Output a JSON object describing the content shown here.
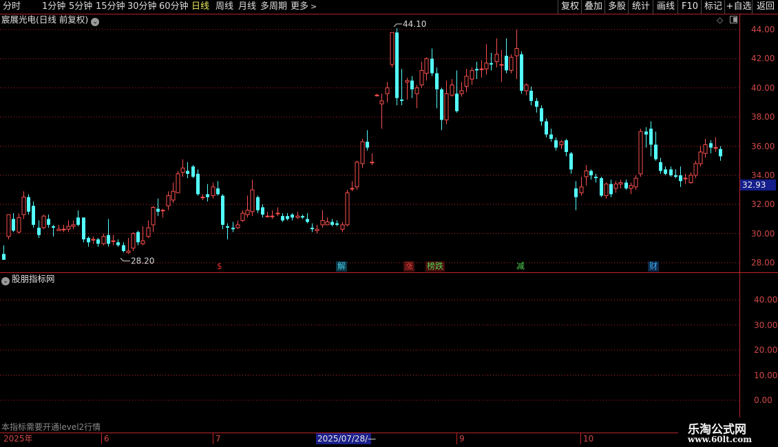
{
  "toolbar": {
    "periods": [
      "分时",
      "1分钟",
      "5分钟",
      "15分钟",
      "30分钟",
      "60分钟",
      "日线",
      "周线",
      "月线",
      "多周期",
      "更多"
    ],
    "active_period": "日线",
    "right_buttons": [
      "复权",
      "叠加",
      "多股",
      "统计",
      "画线",
      "F10",
      "标记",
      "+自选",
      "返回"
    ]
  },
  "stock": {
    "title": "宸展光电(日线 前复权)",
    "max_label": "44.10",
    "min_label": "28.20",
    "last_price": "32.93"
  },
  "events": [
    {
      "label": "$",
      "color": "#e03030",
      "bg": "#000000"
    },
    {
      "label": "解",
      "color": "#40c8e0",
      "bg": "#0d3848"
    },
    {
      "label": "涨",
      "color": "#e04040",
      "bg": "#4a0d0d"
    },
    {
      "label": "榜跌",
      "color": "#50d050",
      "bg": "#4a0d0d"
    },
    {
      "label": "减",
      "color": "#50d050",
      "bg": "#000000"
    },
    {
      "label": "财",
      "color": "#40a8e8",
      "bg": "#0d2848"
    }
  ],
  "main_axis": [
    "44.00",
    "42.00",
    "40.00",
    "38.00",
    "36.00",
    "34.00",
    "32.00",
    "30.00",
    "28.00"
  ],
  "indicator": {
    "title": "股朋指标网",
    "axis": [
      "40.00",
      "30.00",
      "20.00",
      "10.00",
      "0.00"
    ],
    "note": "本指标需要开通level2行情"
  },
  "dates": {
    "labels": [
      "2025年",
      "6",
      "7",
      "9",
      "10"
    ],
    "cursor": "2025/07/28/—"
  },
  "watermark": {
    "cn": "乐淘公式网",
    "url": "www.60lt.com"
  },
  "colors": {
    "up": "#ff5050",
    "down": "#54ffff",
    "grid": "#c0272d",
    "cursor_bg": "#141e8c"
  },
  "chart_data": {
    "type": "candlestick",
    "ylim": [
      27.5,
      44.5
    ],
    "candles": [
      [
        28.6,
        28.2,
        28.2,
        29.2
      ],
      [
        29.8,
        31.3,
        29.6,
        31.3
      ],
      [
        31.0,
        30.2,
        30.1,
        31.4
      ],
      [
        30.1,
        31.1,
        30.0,
        31.4
      ],
      [
        31.3,
        32.5,
        31.0,
        32.9
      ],
      [
        32.5,
        31.5,
        31.3,
        32.7
      ],
      [
        31.9,
        30.6,
        30.4,
        32.2
      ],
      [
        30.4,
        29.9,
        29.7,
        30.9
      ],
      [
        30.4,
        31.2,
        30.3,
        31.3
      ],
      [
        31.0,
        30.6,
        30.4,
        31.3
      ],
      [
        30.5,
        30.4,
        29.8,
        30.6
      ],
      [
        30.2,
        30.3,
        30.2,
        30.6
      ],
      [
        30.3,
        30.3,
        30.1,
        30.6
      ],
      [
        30.3,
        30.5,
        30.1,
        30.9
      ],
      [
        30.5,
        30.6,
        30.3,
        30.9
      ],
      [
        31.1,
        30.6,
        30.5,
        31.6
      ],
      [
        31.1,
        29.6,
        29.4,
        31.1
      ],
      [
        29.7,
        29.4,
        29.1,
        29.8
      ],
      [
        29.6,
        29.6,
        29.3,
        29.8
      ],
      [
        29.6,
        29.3,
        29.1,
        29.7
      ],
      [
        29.3,
        29.8,
        29.2,
        30.0
      ],
      [
        29.9,
        29.3,
        29.1,
        31.0
      ],
      [
        29.5,
        29.5,
        29.2,
        29.9
      ],
      [
        29.4,
        29.2,
        29.1,
        29.6
      ],
      [
        29.2,
        28.8,
        28.7,
        29.4
      ],
      [
        28.7,
        28.8,
        28.6,
        29.7
      ],
      [
        29.0,
        30.0,
        28.8,
        30.1
      ],
      [
        30.1,
        29.4,
        29.2,
        30.2
      ],
      [
        29.3,
        29.5,
        29.2,
        30.5
      ],
      [
        29.8,
        30.4,
        29.7,
        30.9
      ],
      [
        30.6,
        31.8,
        30.1,
        31.9
      ],
      [
        31.7,
        31.5,
        31.2,
        32.4
      ],
      [
        31.6,
        31.6,
        31.1,
        31.7
      ],
      [
        31.9,
        32.6,
        31.6,
        32.9
      ],
      [
        32.3,
        32.9,
        32.1,
        33.5
      ],
      [
        32.8,
        34.1,
        32.8,
        34.3
      ],
      [
        34.2,
        34.5,
        33.9,
        35.1
      ],
      [
        34.3,
        34.1,
        33.8,
        34.9
      ],
      [
        34.6,
        33.9,
        33.8,
        34.7
      ],
      [
        34.1,
        32.7,
        32.6,
        34.4
      ],
      [
        32.5,
        32.5,
        32.3,
        32.7
      ],
      [
        32.7,
        32.5,
        32.2,
        33.4
      ],
      [
        32.6,
        33.2,
        32.4,
        33.5
      ],
      [
        33.1,
        32.7,
        32.6,
        33.6
      ],
      [
        32.6,
        30.6,
        30.3,
        32.7
      ],
      [
        30.5,
        30.4,
        29.6,
        30.7
      ],
      [
        30.4,
        30.3,
        30.1,
        30.8
      ],
      [
        30.4,
        30.6,
        30.3,
        30.9
      ],
      [
        30.9,
        31.4,
        30.8,
        31.6
      ],
      [
        31.3,
        31.6,
        31.1,
        32.6
      ],
      [
        31.5,
        33.0,
        31.2,
        33.7
      ],
      [
        32.5,
        31.6,
        31.4,
        32.6
      ],
      [
        31.8,
        31.3,
        31.1,
        32.0
      ],
      [
        31.2,
        31.2,
        31.1,
        31.5
      ],
      [
        31.2,
        31.2,
        31.0,
        31.6
      ],
      [
        31.4,
        31.4,
        31.2,
        31.8
      ],
      [
        31.2,
        30.9,
        30.8,
        31.4
      ],
      [
        31.2,
        31.0,
        30.9,
        31.4
      ],
      [
        31.3,
        31.1,
        30.9,
        31.4
      ],
      [
        31.1,
        31.2,
        31.0,
        31.5
      ],
      [
        31.2,
        31.1,
        31.0,
        31.3
      ],
      [
        31.0,
        30.8,
        30.7,
        31.4
      ],
      [
        30.4,
        30.3,
        30.1,
        30.7
      ],
      [
        30.2,
        30.3,
        30.0,
        30.6
      ],
      [
        30.6,
        30.9,
        30.4,
        31.6
      ],
      [
        30.6,
        30.8,
        30.6,
        31.1
      ],
      [
        30.8,
        30.6,
        30.5,
        31.0
      ],
      [
        30.7,
        30.6,
        30.5,
        30.9
      ],
      [
        30.3,
        30.6,
        30.1,
        30.8
      ],
      [
        30.6,
        32.8,
        30.5,
        33.0
      ],
      [
        33.1,
        33.1,
        32.9,
        33.6
      ],
      [
        33.2,
        34.9,
        33.0,
        35.0
      ],
      [
        34.8,
        36.3,
        34.5,
        36.5
      ],
      [
        36.3,
        35.9,
        35.7,
        37.1
      ],
      [
        34.9,
        34.9,
        34.7,
        35.5
      ],
      [
        39.5,
        39.5,
        39.4,
        39.6
      ],
      [
        38.9,
        39.1,
        37.2,
        39.6
      ],
      [
        39.6,
        40.0,
        39.0,
        40.4
      ],
      [
        41.6,
        43.8,
        41.4,
        43.8
      ],
      [
        43.8,
        39.3,
        38.8,
        44.1
      ],
      [
        39.2,
        39.1,
        38.8,
        41.3
      ],
      [
        40.4,
        40.5,
        39.2,
        40.7
      ],
      [
        40.5,
        39.9,
        39.3,
        40.8
      ],
      [
        39.6,
        40.0,
        38.6,
        40.2
      ],
      [
        40.2,
        41.2,
        40.0,
        41.8
      ],
      [
        41.0,
        42.0,
        40.5,
        42.1
      ],
      [
        42.0,
        41.0,
        40.8,
        42.7
      ],
      [
        41.0,
        39.9,
        38.6,
        41.4
      ],
      [
        39.9,
        37.8,
        37.1,
        40.0
      ],
      [
        37.8,
        39.6,
        37.5,
        40.5
      ],
      [
        39.5,
        40.2,
        39.4,
        40.6
      ],
      [
        39.6,
        38.4,
        38.3,
        41.2
      ],
      [
        39.6,
        39.8,
        39.4,
        40.4
      ],
      [
        40.1,
        40.8,
        39.7,
        41.3
      ],
      [
        40.6,
        41.2,
        40.2,
        41.4
      ],
      [
        41.3,
        41.2,
        40.6,
        41.8
      ],
      [
        41.3,
        41.3,
        40.7,
        41.9
      ],
      [
        41.3,
        41.7,
        40.9,
        43.0
      ],
      [
        41.7,
        41.6,
        41.2,
        42.4
      ],
      [
        41.8,
        42.3,
        41.4,
        43.4
      ],
      [
        41.6,
        41.6,
        40.4,
        42.6
      ],
      [
        42.2,
        41.2,
        41.0,
        43.4
      ],
      [
        41.2,
        42.1,
        41.0,
        42.3
      ],
      [
        42.2,
        42.7,
        40.6,
        44.0
      ],
      [
        42.3,
        39.8,
        39.6,
        42.5
      ],
      [
        39.8,
        40.2,
        39.5,
        40.3
      ],
      [
        39.8,
        39.1,
        38.8,
        40.1
      ],
      [
        39.1,
        38.7,
        38.3,
        39.3
      ],
      [
        38.6,
        37.7,
        37.4,
        38.8
      ],
      [
        37.7,
        36.8,
        36.6,
        37.9
      ],
      [
        36.8,
        36.5,
        36.3,
        37.2
      ],
      [
        36.4,
        35.9,
        35.7,
        36.6
      ],
      [
        36.1,
        36.3,
        35.8,
        36.4
      ],
      [
        36.4,
        35.6,
        35.3,
        36.5
      ],
      [
        35.5,
        34.4,
        34.1,
        35.6
      ],
      [
        33.1,
        32.5,
        31.6,
        33.6
      ],
      [
        32.8,
        33.2,
        32.6,
        33.9
      ],
      [
        33.9,
        34.3,
        33.3,
        34.7
      ],
      [
        34.3,
        34.0,
        33.7,
        34.4
      ],
      [
        33.9,
        33.8,
        33.5,
        34.1
      ],
      [
        33.8,
        32.6,
        32.5,
        33.9
      ],
      [
        32.6,
        33.4,
        32.4,
        33.5
      ],
      [
        33.4,
        32.7,
        32.5,
        33.7
      ],
      [
        33.1,
        33.4,
        32.8,
        33.6
      ],
      [
        33.4,
        33.5,
        33.1,
        33.7
      ],
      [
        33.5,
        33.1,
        33.0,
        33.7
      ],
      [
        33.1,
        33.3,
        32.7,
        33.5
      ],
      [
        33.2,
        33.8,
        33.0,
        34.0
      ],
      [
        34.1,
        37.0,
        33.9,
        37.2
      ],
      [
        37.0,
        36.8,
        35.9,
        37.3
      ],
      [
        37.2,
        36.1,
        35.3,
        37.7
      ],
      [
        36.1,
        35.1,
        35.0,
        37.0
      ],
      [
        34.9,
        34.3,
        34.1,
        35.2
      ],
      [
        34.4,
        34.1,
        34.0,
        34.6
      ],
      [
        34.4,
        34.0,
        33.9,
        34.6
      ],
      [
        34.0,
        33.9,
        33.8,
        34.4
      ],
      [
        34.0,
        33.6,
        33.2,
        34.6
      ],
      [
        33.8,
        33.8,
        33.4,
        34.1
      ],
      [
        33.5,
        34.0,
        33.4,
        34.2
      ],
      [
        34.0,
        34.8,
        33.8,
        35.0
      ],
      [
        34.8,
        35.6,
        34.6,
        36.0
      ],
      [
        35.5,
        36.1,
        35.2,
        36.5
      ],
      [
        36.2,
        35.9,
        35.5,
        36.4
      ],
      [
        35.9,
        35.9,
        35.6,
        36.6
      ],
      [
        35.8,
        35.3,
        35.0,
        36.0
      ]
    ]
  }
}
